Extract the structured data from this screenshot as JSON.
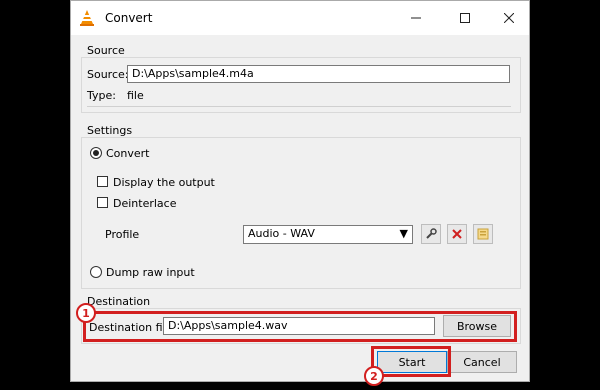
{
  "window": {
    "title": "Convert",
    "controls": [
      "minimize-icon",
      "maximize-icon",
      "close-icon"
    ]
  },
  "source": {
    "group_label": "Source",
    "source_label": "Source:",
    "source_value": "D:\\Apps\\sample4.m4a",
    "type_label": "Type:",
    "type_value": "file"
  },
  "settings": {
    "group_label": "Settings",
    "convert_label": "Convert",
    "display_output_label": "Display the output",
    "deinterlace_label": "Deinterlace",
    "profile_label": "Profile",
    "profile_value": "Audio - WAV",
    "dump_raw_label": "Dump raw input"
  },
  "destination": {
    "group_label": "Destination",
    "file_label": "Destination file:",
    "file_value": "D:\\Apps\\sample4.wav",
    "browse_label": "Browse"
  },
  "actions": {
    "start_label": "Start",
    "cancel_label": "Cancel"
  },
  "annotations": {
    "badge1": "1",
    "badge2": "2",
    "highlight_color": "#d21f1f"
  }
}
